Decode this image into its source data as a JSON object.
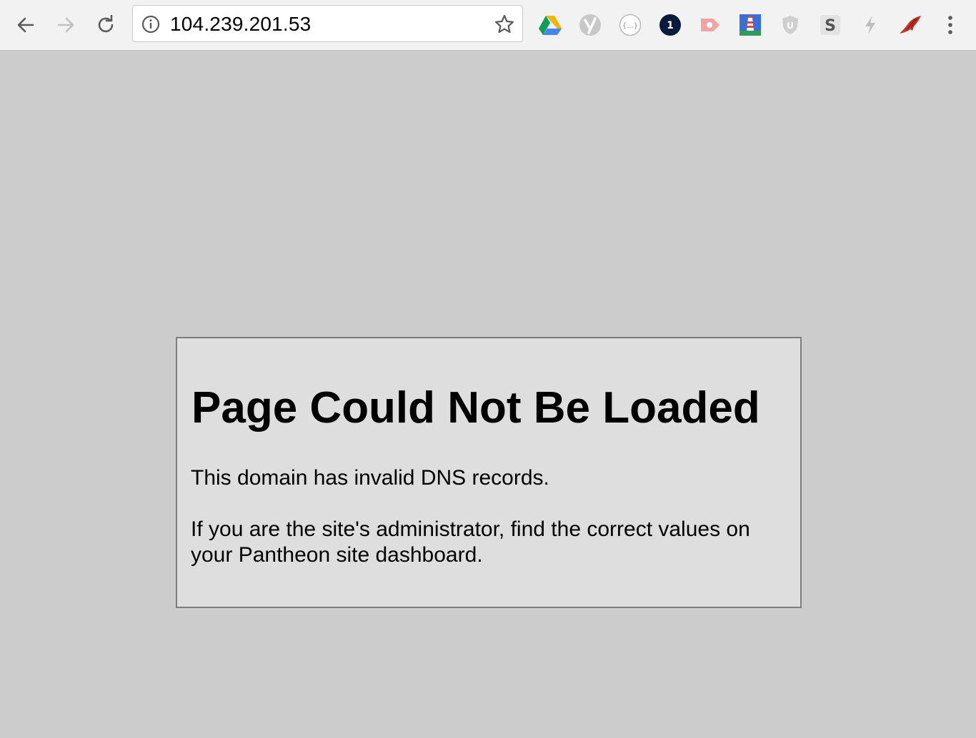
{
  "browser": {
    "url": "104.239.201.53",
    "extensions": [
      {
        "icon": "google-drive-icon"
      },
      {
        "icon": "yoast-icon"
      },
      {
        "icon": "json-formatter-icon",
        "label": "{...}"
      },
      {
        "icon": "1password-icon",
        "label": "1"
      },
      {
        "icon": "video-extension-icon"
      },
      {
        "icon": "lighthouse-icon"
      },
      {
        "icon": "ublock-icon",
        "label": "U"
      },
      {
        "icon": "s-extension-icon",
        "label": "S"
      },
      {
        "icon": "lightning-icon"
      },
      {
        "icon": "eagle-icon"
      }
    ]
  },
  "page": {
    "title": "Page Could Not Be Loaded",
    "message": "This domain has invalid DNS records.",
    "admin_note": "If you are the site's administrator, find the correct values on your Pantheon site dashboard."
  },
  "colors": {
    "page_background": "#cccccc",
    "box_background": "#dedede",
    "box_border": "#7d7d7d"
  }
}
